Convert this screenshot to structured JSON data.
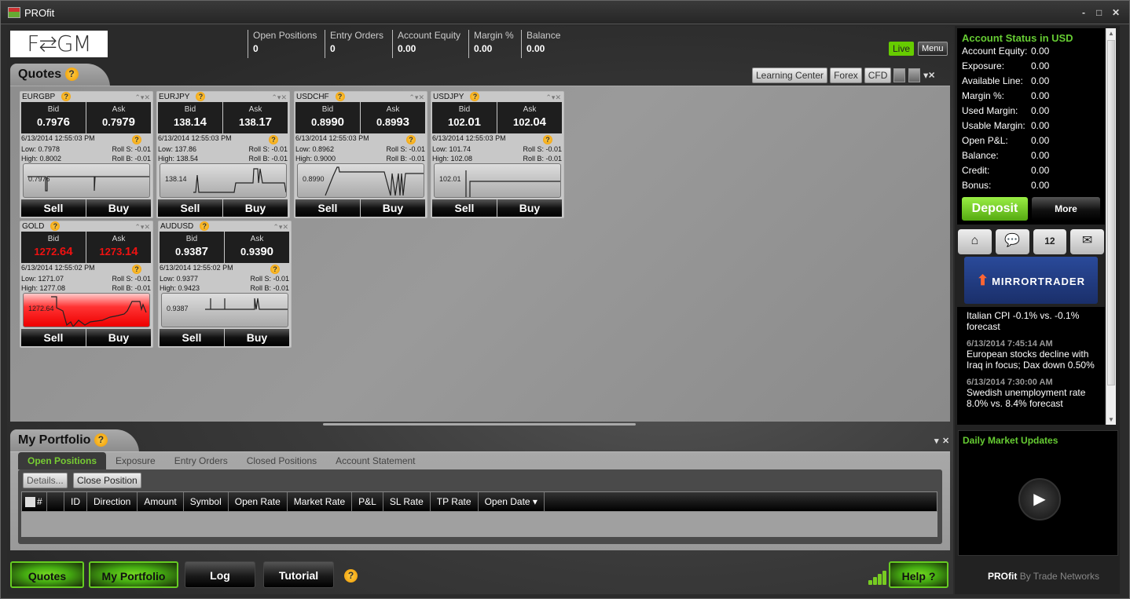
{
  "window": {
    "title": "PROfit",
    "minimize": "-",
    "maximize": "□",
    "close": "✕"
  },
  "header": {
    "logo": "F⇆GM",
    "stats": [
      {
        "label": "Open Positions",
        "value": "0"
      },
      {
        "label": "Entry Orders",
        "value": "0"
      },
      {
        "label": "Account Equity",
        "value": "0.00"
      },
      {
        "label": "Margin %",
        "value": "0.00"
      },
      {
        "label": "Balance",
        "value": "0.00"
      }
    ],
    "live_label": "Live",
    "menu_label": "Menu"
  },
  "quotes": {
    "title": "Quotes",
    "help": "?",
    "toolbar": {
      "learning_center": "Learning Center",
      "forex": "Forex",
      "cfd": "CFD",
      "pin": "▾",
      "close": "✕"
    },
    "panel_controls": "⌃▾✕",
    "bid_label": "Bid",
    "ask_label": "Ask",
    "sell_label": "Sell",
    "buy_label": "Buy",
    "panels": [
      {
        "symbol": "EURGBP",
        "bid_pre": "0.79",
        "bid_big": "76",
        "ask_pre": "0.79",
        "ask_big": "79",
        "time": "6/13/2014 12:55:03 PM",
        "low": "Low: 0.7978",
        "high": "High: 0.8002",
        "roll_s": "Roll S: -0.01",
        "roll_b": "Roll B: -0.01",
        "level": "0.7976",
        "red": false
      },
      {
        "symbol": "EURJPY",
        "bid_pre": "138.",
        "bid_big": "14",
        "ask_pre": "138.",
        "ask_big": "17",
        "time": "6/13/2014 12:55:03 PM",
        "low": "Low: 137.86",
        "high": "High: 138.54",
        "roll_s": "Roll S: -0.01",
        "roll_b": "Roll B: -0.01",
        "level": "138.14",
        "red": false
      },
      {
        "symbol": "USDCHF",
        "bid_pre": "0.89",
        "bid_big": "90",
        "ask_pre": "0.89",
        "ask_big": "93",
        "time": "6/13/2014 12:55:03 PM",
        "low": "Low: 0.8962",
        "high": "High: 0.9000",
        "roll_s": "Roll S: -0.01",
        "roll_b": "Roll B: -0.01",
        "level": "0.8990",
        "red": false
      },
      {
        "symbol": "USDJPY",
        "bid_pre": "102.",
        "bid_big": "01",
        "ask_pre": "102.",
        "ask_big": "04",
        "time": "6/13/2014 12:55:03 PM",
        "low": "Low: 101.74",
        "high": "High: 102.08",
        "roll_s": "Roll S: -0.01",
        "roll_b": "Roll B: -0.01",
        "level": "102.01",
        "red": false
      },
      {
        "symbol": "GOLD",
        "bid_pre": "1272.",
        "bid_big": "64",
        "ask_pre": "1273.",
        "ask_big": "14",
        "time": "6/13/2014 12:55:02 PM",
        "low": "Low: 1271.07",
        "high": "High: 1277.08",
        "roll_s": "Roll S: -0.01",
        "roll_b": "Roll B: -0.01",
        "level": "1272.64",
        "red": true
      },
      {
        "symbol": "AUDUSD",
        "bid_pre": "0.93",
        "bid_big": "87",
        "ask_pre": "0.93",
        "ask_big": "90",
        "time": "6/13/2014 12:55:02 PM",
        "low": "Low: 0.9377",
        "high": "High: 0.9423",
        "roll_s": "Roll S: -0.01",
        "roll_b": "Roll B: -0.01",
        "level": "0.9387",
        "red": false
      }
    ]
  },
  "portfolio": {
    "title": "My Portfolio",
    "tabs": [
      "Open Positions",
      "Exposure",
      "Entry Orders",
      "Closed Positions",
      "Account Statement"
    ],
    "active_tab": "Open Positions",
    "details_label": "Details...",
    "close_position_label": "Close Position",
    "columns": [
      "#",
      "",
      "ID",
      "Direction",
      "Amount",
      "Symbol",
      "Open Rate",
      "Market Rate",
      "P&L",
      "SL Rate",
      "TP Rate",
      "Open Date ▾"
    ]
  },
  "bottom": {
    "quotes": "Quotes",
    "portfolio": "My Portfolio",
    "log": "Log",
    "tutorial": "Tutorial",
    "help": "Help ?"
  },
  "account": {
    "title": "Account Status in USD",
    "rows": [
      {
        "k": "Account Equity:",
        "v": "0.00"
      },
      {
        "k": "Exposure:",
        "v": "0.00"
      },
      {
        "k": "Available Line:",
        "v": "0.00"
      },
      {
        "k": "Margin %:",
        "v": "0.00"
      },
      {
        "k": "Used Margin:",
        "v": "0.00"
      },
      {
        "k": "Usable Margin:",
        "v": "0.00"
      },
      {
        "k": "Open P&L:",
        "v": "0.00"
      },
      {
        "k": "Balance:",
        "v": "0.00"
      },
      {
        "k": "Credit:",
        "v": "0.00"
      },
      {
        "k": "Bonus:",
        "v": "0.00"
      }
    ],
    "deposit": "Deposit",
    "more": "More"
  },
  "side_icons": {
    "home": "⌂",
    "chat": "💬",
    "calendar": "12",
    "mail": "✉"
  },
  "mirror_trader": "MIRRORTRADER",
  "news": [
    {
      "date": "",
      "text": "Italian CPI -0.1% vs. -0.1% forecast"
    },
    {
      "date": "6/13/2014 7:45:14 AM",
      "text": "European stocks decline with Iraq in focus; Dax down 0.50%"
    },
    {
      "date": "6/13/2014 7:30:00 AM",
      "text": "Swedish unemployment rate 8.0% vs. 8.4% forecast"
    }
  ],
  "video": {
    "title": "Daily Market Updates",
    "play": "▶"
  },
  "brand": {
    "name": "PROfit",
    "by": "By Trade Networks"
  }
}
